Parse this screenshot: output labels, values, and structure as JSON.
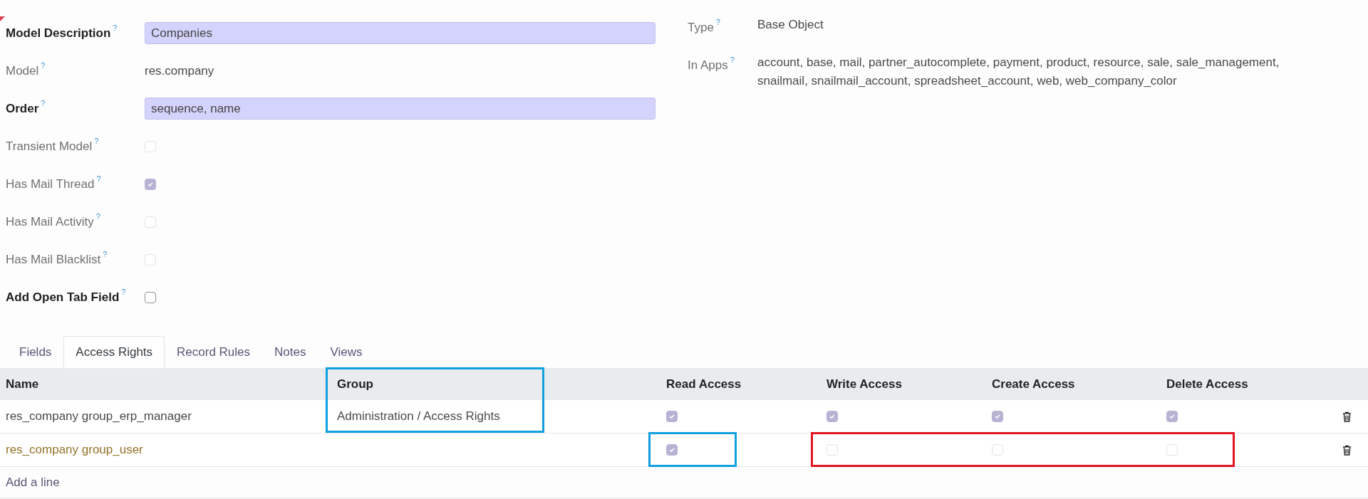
{
  "left_fields": [
    {
      "label": "Model Description",
      "help": "?",
      "bold": true,
      "flagged": true,
      "kind": "input",
      "value": "Companies"
    },
    {
      "label": "Model",
      "help": "?",
      "bold": false,
      "flagged": false,
      "kind": "text",
      "value": "res.company"
    },
    {
      "label": "Order",
      "help": "?",
      "bold": true,
      "flagged": false,
      "kind": "input",
      "value": "sequence, name"
    },
    {
      "label": "Transient Model",
      "help": "?",
      "bold": false,
      "flagged": false,
      "kind": "checkbox",
      "checked": false,
      "disabled": true
    },
    {
      "label": "Has Mail Thread",
      "help": "?",
      "bold": false,
      "flagged": false,
      "kind": "checkbox",
      "checked": true,
      "disabled": true
    },
    {
      "label": "Has Mail Activity",
      "help": "?",
      "bold": false,
      "flagged": false,
      "kind": "checkbox",
      "checked": false,
      "disabled": true
    },
    {
      "label": "Has Mail Blacklist",
      "help": "?",
      "bold": false,
      "flagged": false,
      "kind": "checkbox",
      "checked": false,
      "disabled": true
    },
    {
      "label": "Add Open Tab Field",
      "help": "?",
      "bold": true,
      "flagged": false,
      "kind": "checkbox",
      "checked": false,
      "disabled": false
    }
  ],
  "right_fields": [
    {
      "label": "Type",
      "help": "?",
      "value": "Base Object"
    },
    {
      "label": "In Apps",
      "help": "?",
      "value": "account, base, mail, partner_autocomplete, payment, product, resource, sale, sale_management, snailmail, snailmail_account, spreadsheet_account, web, web_company_color"
    }
  ],
  "tabs": [
    {
      "label": "Fields",
      "selected": false
    },
    {
      "label": "Access Rights",
      "selected": true
    },
    {
      "label": "Record Rules",
      "selected": false
    },
    {
      "label": "Notes",
      "selected": false
    },
    {
      "label": "Views",
      "selected": false
    }
  ],
  "table": {
    "columns": [
      "Name",
      "Group",
      "Read Access",
      "Write Access",
      "Create Access",
      "Delete Access"
    ],
    "rows": [
      {
        "name": "res_company group_erp_manager",
        "color": "#4a4a4a",
        "group": "Administration / Access Rights",
        "read": true,
        "write": true,
        "create": true,
        "delete": true
      },
      {
        "name": "res_company group_user",
        "color": "#94722a",
        "read": true,
        "write": false,
        "create": false,
        "delete": false
      }
    ],
    "add_line": "Add a line"
  },
  "annotations": [
    {
      "color": "#119fdf"
    },
    {
      "color": "#119fdf"
    },
    {
      "color": "#e3141f"
    }
  ]
}
